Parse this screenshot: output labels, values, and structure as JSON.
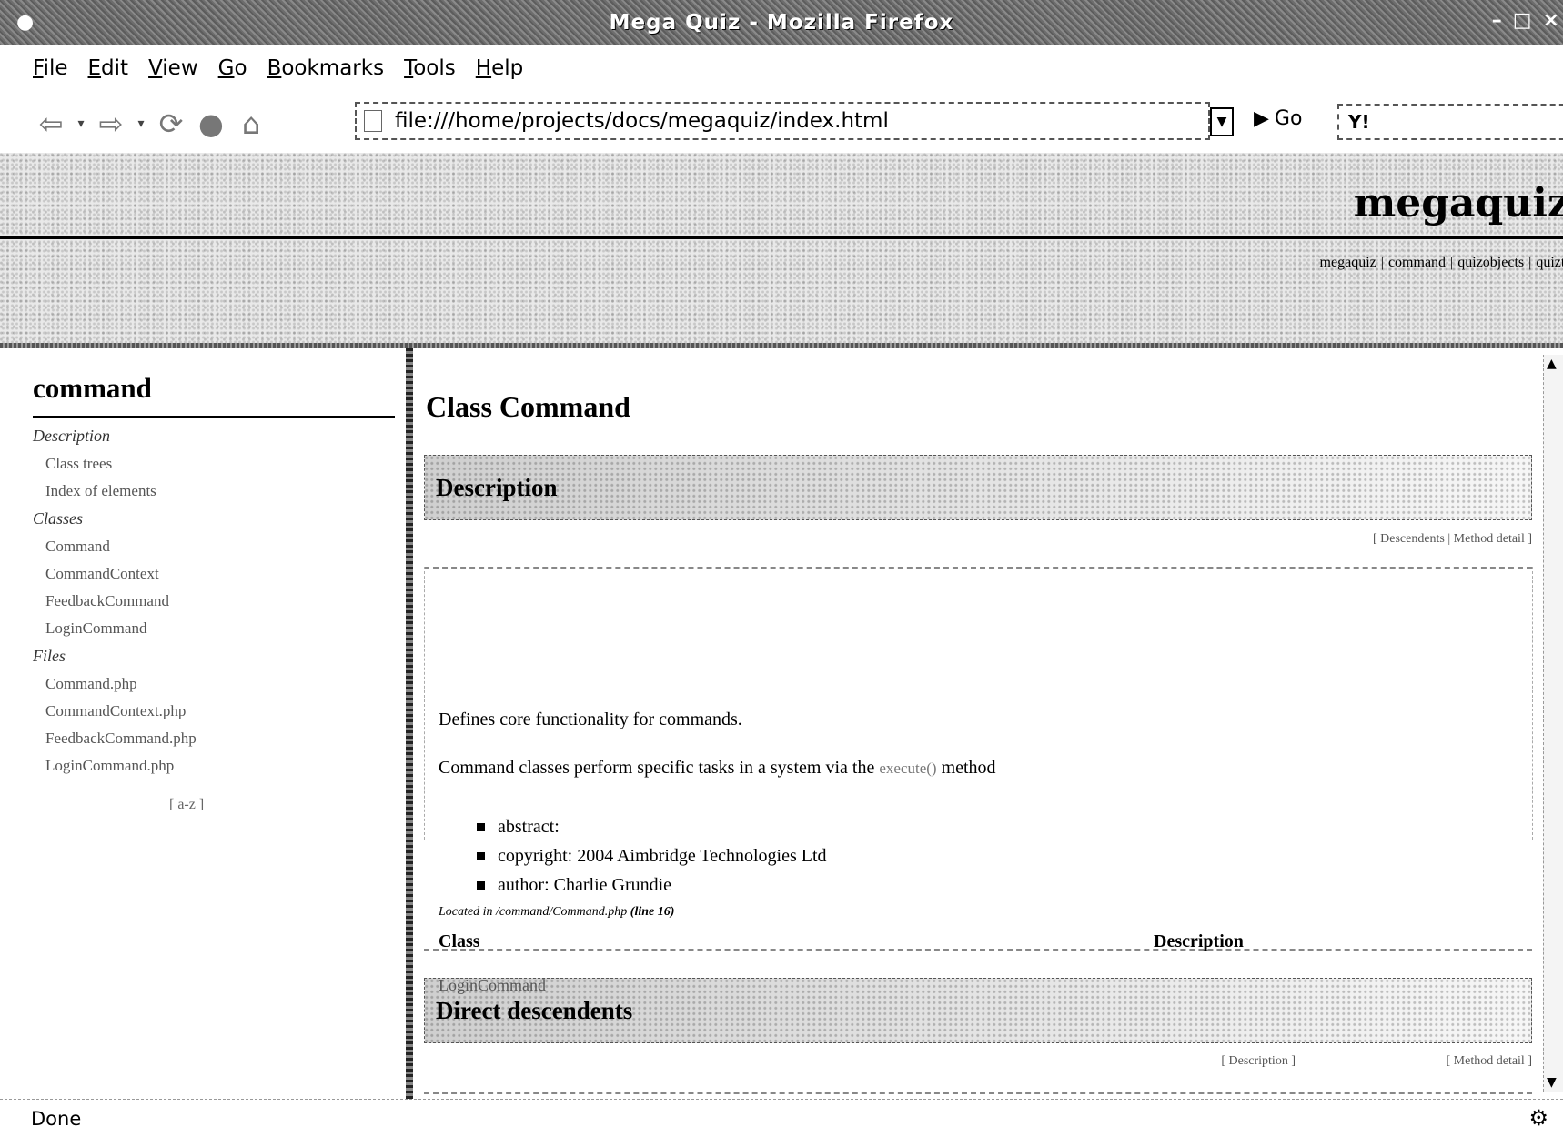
{
  "window": {
    "title": "Mega Quiz - Mozilla Firefox"
  },
  "menubar": {
    "items": [
      "File",
      "Edit",
      "View",
      "Go",
      "Bookmarks",
      "Tools",
      "Help"
    ]
  },
  "toolbar": {
    "url": "file:///home/projects/docs/megaquiz/index.html",
    "go_label": "Go",
    "search_text": "Y!"
  },
  "banner": {
    "site_title": "megaquiz",
    "links": [
      "megaquiz",
      "command",
      "quizobjects",
      "quiztools"
    ]
  },
  "sidebar": {
    "title": "command",
    "groups": [
      {
        "heading": "Description",
        "items": [
          "Class trees",
          "Index of elements"
        ]
      },
      {
        "heading": "Classes",
        "items": [
          "Command",
          "CommandContext",
          "FeedbackCommand",
          "LoginCommand"
        ]
      },
      {
        "heading": "Files",
        "items": [
          "Command.php",
          "CommandContext.php",
          "FeedbackCommand.php",
          "LoginCommand.php"
        ]
      }
    ],
    "footer": "[ a-z ]"
  },
  "main": {
    "class_title": "Class Command",
    "description_heading": "Description",
    "description_nav": "[ Descendents | Method detail ]",
    "summary": "Defines core functionality for commands.",
    "body_prefix": "Command classes perform specific tasks in a system via the",
    "body_code": "execute()",
    "body_suffix": "method",
    "tags": [
      "abstract:",
      "copyright: 2004 Aimbridge Technologies Ltd",
      "author: Charlie Grundie"
    ],
    "located_prefix": "Located in",
    "located_file": "/command/Command.php",
    "located_line": "(line 16)",
    "descendents_heading": "Direct descendents",
    "descendents_nav_left": "[ Description ]",
    "descendents_nav_right": "[ Method detail ]",
    "table_headers": [
      "Class",
      "Description"
    ],
    "table_rows": [
      [
        "LoginCommand",
        ""
      ]
    ]
  },
  "statusbar": {
    "text": "Done"
  }
}
